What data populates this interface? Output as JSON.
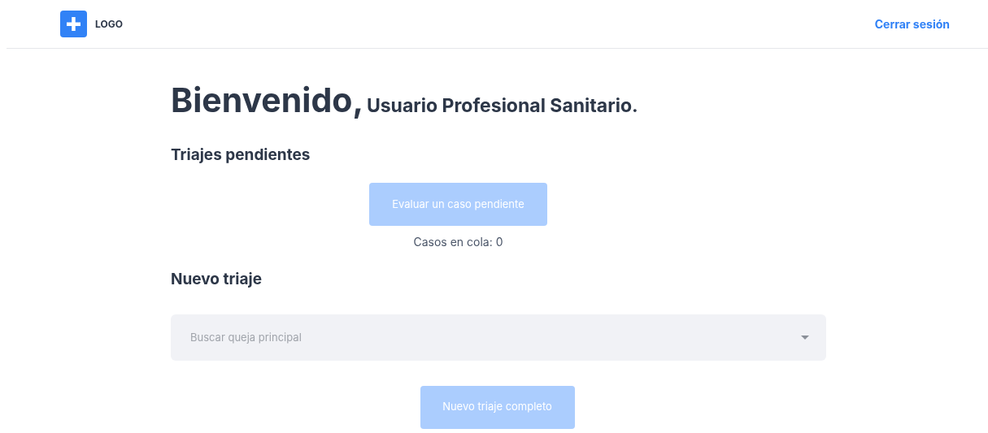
{
  "header": {
    "logo": "LOGO",
    "logout": "Cerrar sesión"
  },
  "welcome": {
    "greeting": "Bienvenido,",
    "user": "Usuario Profesional Sanitario."
  },
  "pending": {
    "heading": "Triajes pendientes",
    "button": {
      "label": "Evaluar un caso pendiente",
      "disabled": true
    },
    "queue": "Casos en cola: 0"
  },
  "new_triage": {
    "heading": "Nuevo triaje",
    "search": {
      "placeholder": "Buscar queja principal"
    },
    "button": {
      "label": "Nuevo triaje completo",
      "disabled": true
    }
  }
}
